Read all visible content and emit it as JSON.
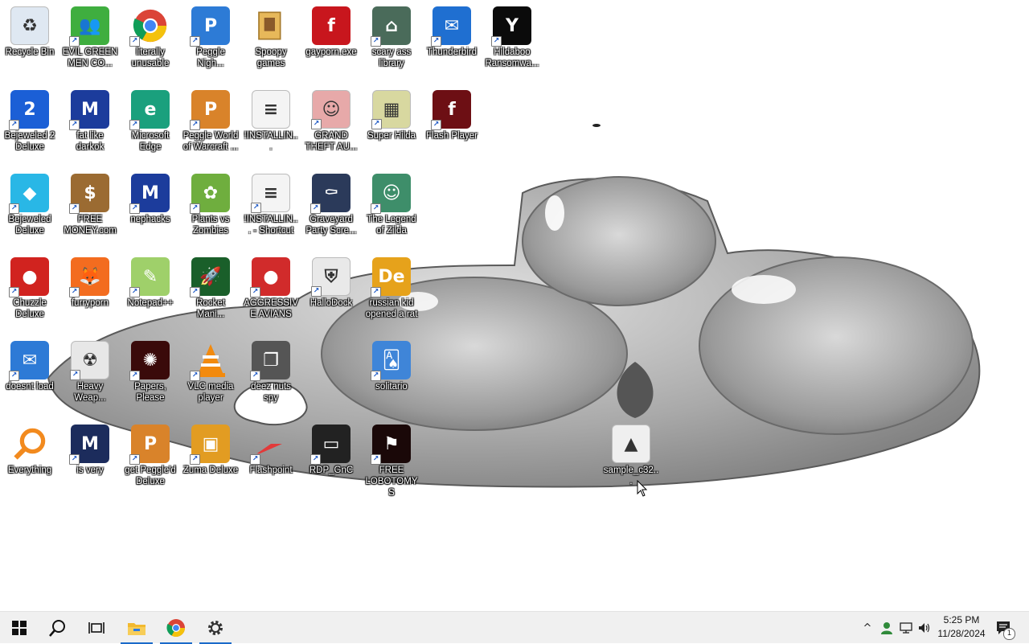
{
  "desktop": {
    "icons": [
      {
        "label": "Recycle Bin",
        "icon": "recycle-bin-icon",
        "color": "#dfe8f2",
        "glyph": "♻",
        "shortcut": false
      },
      {
        "label": "EVIL GREEN MEN CO...",
        "icon": "users-icon",
        "color": "#3fae3f",
        "glyph": "👥",
        "shortcut": true
      },
      {
        "label": "literally unusable",
        "icon": "chrome-icon",
        "color": "#ffffff",
        "glyph": "",
        "shortcut": true
      },
      {
        "label": "Peggle Nigh...",
        "icon": "peggle-icon",
        "color": "#2d7bd6",
        "glyph": "P",
        "shortcut": true
      },
      {
        "label": "Spoopy games",
        "icon": "folder-icon",
        "color": "#e7b85a",
        "glyph": "",
        "shortcut": false
      },
      {
        "label": "gayporn.exe",
        "icon": "flash-icon",
        "color": "#c8161d",
        "glyph": "f",
        "shortcut": false
      },
      {
        "label": "scary ass library",
        "icon": "library-icon",
        "color": "#4a6b5a",
        "glyph": "⌂",
        "shortcut": true
      },
      {
        "label": "Thunderbird",
        "icon": "thunderbird-icon",
        "color": "#1f6fd1",
        "glyph": "✉",
        "shortcut": true
      },
      {
        "label": "Hildaboo Ransomwa...",
        "icon": "yashma-icon",
        "color": "#0b0b0b",
        "glyph": "Y",
        "shortcut": true
      },
      {
        "label": "Bejeweled 2 Deluxe",
        "icon": "bejeweled2-icon",
        "color": "#1b5fd6",
        "glyph": "2",
        "shortcut": true
      },
      {
        "label": "fat like darkok",
        "icon": "mpi-icon",
        "color": "#1c3c9c",
        "glyph": "M",
        "shortcut": true
      },
      {
        "label": "Microsoft Edge",
        "icon": "edge-icon",
        "color": "#1aa07d",
        "glyph": "e",
        "shortcut": true
      },
      {
        "label": "Peggle World of Warcraft ...",
        "icon": "peggle-wow-icon",
        "color": "#d9832a",
        "glyph": "P",
        "shortcut": true
      },
      {
        "label": "!INSTALLIN...",
        "icon": "text-file-icon",
        "color": "#f4f4f4",
        "glyph": "≡",
        "shortcut": false
      },
      {
        "label": "GRAND THEFT AU...",
        "icon": "gta-icon",
        "color": "#e7a9a9",
        "glyph": "☺",
        "shortcut": true
      },
      {
        "label": "Super Hilda",
        "icon": "super-hilda-icon",
        "color": "#d8d8a0",
        "glyph": "▦",
        "shortcut": true
      },
      {
        "label": "Flash Player",
        "icon": "flash-player-icon",
        "color": "#6d0f14",
        "glyph": "f",
        "shortcut": true
      },
      {
        "label": "Bejeweled Deluxe",
        "icon": "diamond-icon",
        "color": "#29b7e6",
        "glyph": "◆",
        "shortcut": true
      },
      {
        "label": "FREE MONEY.com",
        "icon": "money-bag-icon",
        "color": "#9b6b32",
        "glyph": "$",
        "shortcut": true
      },
      {
        "label": "nephacks",
        "icon": "mpi-icon",
        "color": "#1c3c9c",
        "glyph": "M",
        "shortcut": true
      },
      {
        "label": "Plants vs Zombies",
        "icon": "plant-icon",
        "color": "#6fae3e",
        "glyph": "✿",
        "shortcut": true
      },
      {
        "label": "!INSTALLIN... - Shortcut",
        "icon": "text-file-icon",
        "color": "#f4f4f4",
        "glyph": "≡",
        "shortcut": true
      },
      {
        "label": "Graveyard Party Scre...",
        "icon": "graveyard-icon",
        "color": "#2b3a5a",
        "glyph": "⚰",
        "shortcut": true
      },
      {
        "label": "The Legend of Zilda",
        "icon": "zilda-icon",
        "color": "#3e8e6a",
        "glyph": "☺",
        "shortcut": true
      },
      {
        "label": "Chuzzle Deluxe",
        "icon": "chuzzle-icon",
        "color": "#d1231f",
        "glyph": "●",
        "shortcut": true
      },
      {
        "label": "furryporn",
        "icon": "firefox-icon",
        "color": "#f36c1f",
        "glyph": "🦊",
        "shortcut": true
      },
      {
        "label": "Notepad++",
        "icon": "notepad-plus-icon",
        "color": "#9fd06a",
        "glyph": "✎",
        "shortcut": true
      },
      {
        "label": "Rocket Mani...",
        "icon": "rocket-icon",
        "color": "#1a5f2a",
        "glyph": "🚀",
        "shortcut": true
      },
      {
        "label": "AGGRESSIVE AVIANS",
        "icon": "angry-bird-icon",
        "color": "#d12b2b",
        "glyph": "●",
        "shortcut": true
      },
      {
        "label": "HalloDock",
        "icon": "shield-icon",
        "color": "#e9e9e9",
        "glyph": "⛨",
        "shortcut": true
      },
      {
        "label": "russian kid opened a rat",
        "icon": "de-icon",
        "color": "#e6a21b",
        "glyph": "De",
        "shortcut": true
      },
      {
        "label": "doesnt load",
        "icon": "thunderbird-icon",
        "color": "#2d7ad6",
        "glyph": "✉",
        "shortcut": true
      },
      {
        "label": "Heavy Weap...",
        "icon": "radiation-icon",
        "color": "#e7e7e7",
        "glyph": "☢",
        "shortcut": true
      },
      {
        "label": "Papers, Please",
        "icon": "papers-please-icon",
        "color": "#3a0a0a",
        "glyph": "✺",
        "shortcut": true
      },
      {
        "label": "VLC media player",
        "icon": "vlc-icon",
        "color": "#ffffff",
        "glyph": "",
        "shortcut": true
      },
      {
        "label": "deez nuts spy",
        "icon": "windows-stack-icon",
        "color": "#555555",
        "glyph": "❐",
        "shortcut": true
      },
      {
        "label": "solitario",
        "icon": "solitaire-icon",
        "color": "#3f85d8",
        "glyph": "🂡",
        "shortcut": true
      },
      {
        "label": "Everything",
        "icon": "magnifier-icon",
        "color": "#ffffff",
        "glyph": "",
        "shortcut": false
      },
      {
        "label": "is very",
        "icon": "mpi-shield-icon",
        "color": "#1c2c5c",
        "glyph": "M",
        "shortcut": true
      },
      {
        "label": "get Peggle'd Deluxe",
        "icon": "peggle-icon",
        "color": "#d9832a",
        "glyph": "P",
        "shortcut": true
      },
      {
        "label": "Zuma Deluxe",
        "icon": "zuma-icon",
        "color": "#e29c22",
        "glyph": "▣",
        "shortcut": true
      },
      {
        "label": "Flashpoint",
        "icon": "flashpoint-icon",
        "color": "#ffffff",
        "glyph": "",
        "shortcut": true
      },
      {
        "label": "RDP_GnC",
        "icon": "rdp-icon",
        "color": "#222222",
        "glyph": "▭",
        "shortcut": true
      },
      {
        "label": "FREE LOBOTOMYS",
        "icon": "lobotomy-icon",
        "color": "#1a0808",
        "glyph": "⚑",
        "shortcut": true
      },
      {
        "label": "sample_c32...",
        "icon": "image-file-icon",
        "color": "#efefef",
        "glyph": "▲",
        "shortcut": false
      }
    ]
  },
  "taskbar": {
    "start": "windows-start-icon",
    "search": "search-icon",
    "task_view": "task-view-icon",
    "pinned": [
      {
        "name": "file-explorer-icon",
        "color": "#f2b92f",
        "active": true
      },
      {
        "name": "chrome-icon",
        "color": "#ffffff",
        "active": true
      },
      {
        "name": "settings-gear-icon",
        "color": "#444444",
        "active": true
      }
    ],
    "tray": {
      "chevron": "^",
      "people": "people-icon",
      "network": "network-icon",
      "volume": "volume-icon",
      "time": "5:25 PM",
      "date": "11/28/2024",
      "notifications_count": "1",
      "accent": "#1b6ac9"
    }
  }
}
